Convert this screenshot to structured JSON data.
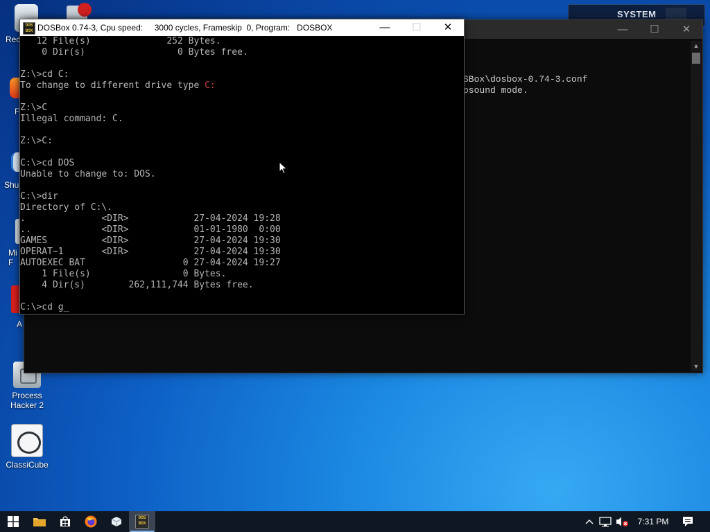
{
  "desktop": {
    "icons": [
      {
        "label": "Rec",
        "icon": "recycle-bin-icon"
      },
      {
        "label": "F",
        "icon": "firefox-icon"
      },
      {
        "label": "Shu",
        "icon": "shutdown-icon"
      },
      {
        "label": "Mi\nF",
        "icon": "app-icon"
      },
      {
        "label": "A",
        "icon": "adobe-icon"
      },
      {
        "label": "Process\nHacker 2",
        "icon": "process-hacker-icon"
      },
      {
        "label": "ClassiCube",
        "icon": "classicube-icon"
      }
    ],
    "system_widget_label": "SYSTEM"
  },
  "back_window": {
    "lines": [
      "SBox\\dosbox-0.74-3.conf",
      "psound mode."
    ],
    "minimize": "—",
    "maximize": "☐",
    "close": "✕"
  },
  "dosbox": {
    "title": "DOSBox 0.74-3, Cpu speed:     3000 cycles, Frameskip  0, Program:   DOSBOX",
    "logo_text": "DOS\nBOX",
    "minimize": "—",
    "maximize": "☐",
    "close": "✕",
    "lines": [
      "   12 File(s)              252 Bytes.",
      "    0 Dir(s)                 0 Bytes free.",
      "",
      "Z:\\>cd C:",
      "To change to different drive type ",
      "",
      "Z:\\>C",
      "Illegal command: C.",
      "",
      "Z:\\>C:",
      "",
      "C:\\>cd DOS",
      "Unable to change to: DOS.",
      "",
      "C:\\>dir",
      "Directory of C:\\.",
      ".              <DIR>            27-04-2024 19:28",
      "..             <DIR>            01-01-1980  0:00",
      "GAMES          <DIR>            27-04-2024 19:30",
      "OPERAT~1       <DIR>            27-04-2024 19:30",
      "AUTOEXEC BAT                  0 27-04-2024 19:27",
      "    1 File(s)                 0 Bytes.",
      "    4 Dir(s)        262,111,744 Bytes free.",
      "",
      "C:\\>cd g_"
    ],
    "highlight": "C:"
  },
  "taskbar": {
    "clock": "7:31 PM",
    "items": [
      {
        "name": "start-button",
        "icon": "windows-logo-icon"
      },
      {
        "name": "taskbar-file-explorer",
        "icon": "folder-icon"
      },
      {
        "name": "taskbar-store",
        "icon": "store-icon"
      },
      {
        "name": "taskbar-firefox",
        "icon": "firefox-icon"
      },
      {
        "name": "taskbar-app",
        "icon": "cube-icon"
      },
      {
        "name": "taskbar-dosbox",
        "icon": "dosbox-icon",
        "active": true
      }
    ]
  },
  "colors": {
    "console_text": "#b6b6b6",
    "highlight_red": "#c43c3c",
    "accent": "#7fb4ee"
  }
}
